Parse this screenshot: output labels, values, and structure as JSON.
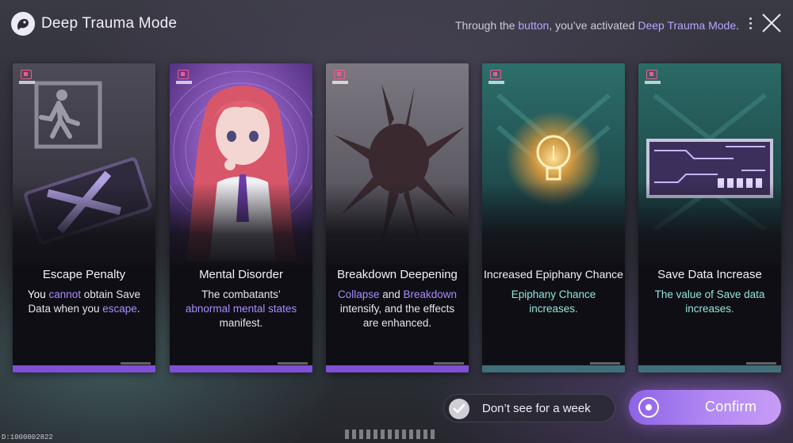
{
  "header": {
    "title": "Deep Trauma Mode",
    "notice_prefix": "Through the ",
    "notice_button": "button",
    "notice_mid": ", you’ve activated ",
    "notice_mode": "Deep Trauma Mode",
    "notice_suffix": ".",
    "logo_icon": "logo-icon",
    "more_icon": "more-icon",
    "close_icon": "close-icon"
  },
  "cards": [
    {
      "title": "Escape Penalty",
      "art_icon": "emergency-exit-icon",
      "desc": [
        {
          "t": "You ",
          "c": "w"
        },
        {
          "t": "cannot",
          "c": "h"
        },
        {
          "t": " obtain Save Data when you ",
          "c": "w"
        },
        {
          "t": "escape",
          "c": "h"
        },
        {
          "t": ".",
          "c": "w"
        }
      ]
    },
    {
      "title": "Mental Disorder",
      "art_icon": "character-portrait",
      "desc": [
        {
          "t": "The combatants’ ",
          "c": "w"
        },
        {
          "t": "abnormal mental states",
          "c": "h"
        },
        {
          "t": " manifest.",
          "c": "w"
        }
      ]
    },
    {
      "title": "Breakdown Deepening",
      "art_icon": "shadow-creature-icon",
      "desc": [
        {
          "t": "Collapse",
          "c": "h"
        },
        {
          "t": " and ",
          "c": "w"
        },
        {
          "t": "Breakdown",
          "c": "h"
        },
        {
          "t": " intensify, and the effects are enhanced.",
          "c": "w"
        }
      ]
    },
    {
      "title": "Increased Epiphany Chance",
      "art_icon": "lightbulb-icon",
      "desc": [
        {
          "t": "Epiphany Chance increases.",
          "c": "t"
        }
      ]
    },
    {
      "title": "Save Data Increase",
      "art_icon": "circuit-chip-icon",
      "desc": [
        {
          "t": "The value of Save data increases.",
          "c": "t"
        }
      ]
    }
  ],
  "footer": {
    "week_label": "Don’t see for a week",
    "week_checked": true,
    "confirm_label": "Confirm",
    "build_id": "D:1000002822"
  },
  "colors": {
    "accent_violet": "#a98cff",
    "accent_teal": "#86e3d9",
    "confirm_gradient_start": "#8e63e6",
    "confirm_gradient_end": "#c79cf6"
  }
}
